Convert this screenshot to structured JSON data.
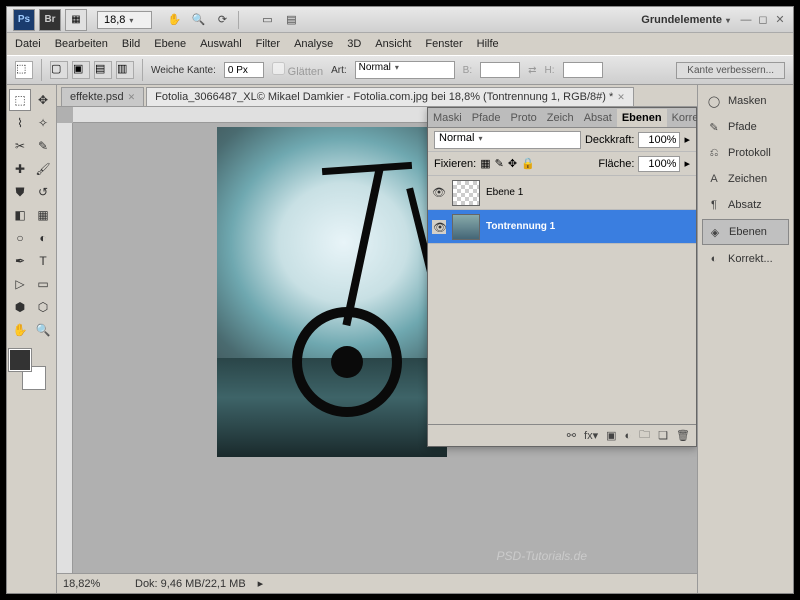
{
  "titlebar": {
    "zoom": "18,8",
    "workspace": "Grundelemente"
  },
  "menu": [
    "Datei",
    "Bearbeiten",
    "Bild",
    "Ebene",
    "Auswahl",
    "Filter",
    "Analyse",
    "3D",
    "Ansicht",
    "Fenster",
    "Hilfe"
  ],
  "options": {
    "feather_label": "Weiche Kante:",
    "feather_value": "0 Px",
    "antialias": "Glätten",
    "style_label": "Art:",
    "style_value": "Normal",
    "width_label": "B:",
    "height_label": "H:",
    "refine": "Kante verbessern..."
  },
  "tabs": [
    {
      "label": "effekte.psd",
      "active": false
    },
    {
      "label": "Fotolia_3066487_XL© Mikael Damkier - Fotolia.com.jpg bei 18,8% (Tontrennung 1, RGB/8#) *",
      "active": true
    }
  ],
  "layers_panel": {
    "tabs": [
      "Maski",
      "Pfade",
      "Proto",
      "Zeich",
      "Absat",
      "Ebenen",
      "Korre"
    ],
    "active_tab": "Ebenen",
    "blend_mode": "Normal",
    "opacity_label": "Deckkraft:",
    "opacity": "100%",
    "lock_label": "Fixieren:",
    "fill_label": "Fläche:",
    "fill": "100%",
    "layers": [
      {
        "name": "Ebene 1",
        "selected": false,
        "checker": true
      },
      {
        "name": "Tontrennung 1",
        "selected": true,
        "checker": false
      }
    ]
  },
  "right_panels": [
    {
      "label": "Masken",
      "icon": "◯"
    },
    {
      "label": "Pfade",
      "icon": "✎"
    },
    {
      "label": "Protokoll",
      "icon": "⎌"
    },
    {
      "label": "Zeichen",
      "icon": "A"
    },
    {
      "label": "Absatz",
      "icon": "¶"
    },
    {
      "label": "Ebenen",
      "icon": "◈",
      "active": true
    },
    {
      "label": "Korrekt...",
      "icon": "◐"
    }
  ],
  "status": {
    "zoom": "18,82%",
    "doc": "Dok: 9,46 MB/22,1 MB"
  },
  "watermark": "PSD-Tutorials.de"
}
